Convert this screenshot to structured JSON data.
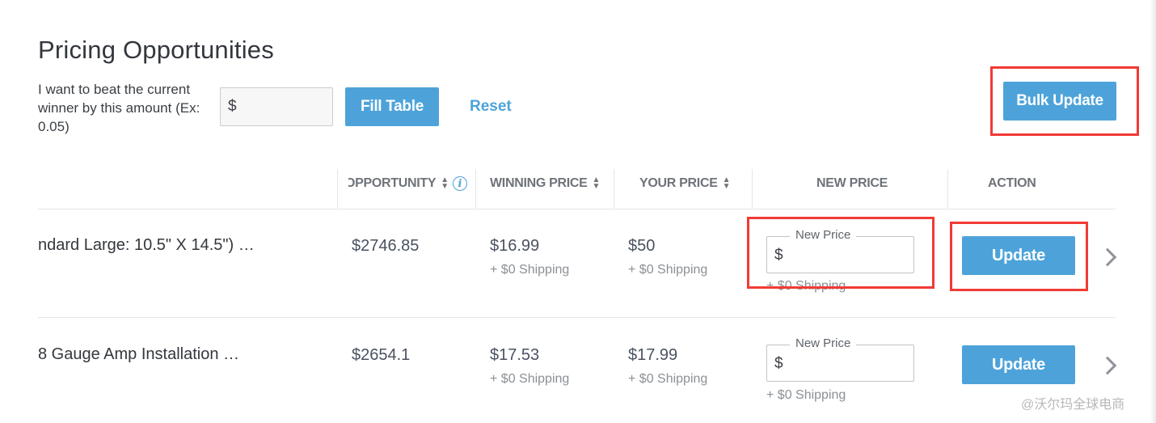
{
  "header": {
    "title": "Pricing Opportunities",
    "beat_label": "I want to beat the current winner by this amount (Ex: 0.05)",
    "beat_input_prefix": "$",
    "fill_table_label": "Fill Table",
    "reset_label": "Reset",
    "bulk_update_label": "Bulk Update"
  },
  "table": {
    "columns": [
      "OPPORTUNITY",
      "WINNING PRICE",
      "YOUR PRICE",
      "NEW PRICE",
      "ACTION"
    ],
    "rows": [
      {
        "product": "ndard Large: 10.5\" X 14.5\") …",
        "opportunity": "$2746.85",
        "winning_price": "$16.99",
        "winning_shipping": "+ $0 Shipping",
        "your_price": "$50",
        "your_shipping": "+ $0 Shipping",
        "new_price_label": "New Price",
        "new_price_prefix": "$",
        "new_price_shipping": "+ $0 Shipping",
        "action_label": "Update"
      },
      {
        "product": "8 Gauge Amp Installation …",
        "opportunity": "$2654.1",
        "winning_price": "$17.53",
        "winning_shipping": "+ $0 Shipping",
        "your_price": "$17.99",
        "your_shipping": "+ $0 Shipping",
        "new_price_label": "New Price",
        "new_price_prefix": "$",
        "new_price_shipping": "+ $0 Shipping",
        "action_label": "Update"
      }
    ]
  },
  "icons": {
    "sort": "sort-icon",
    "info": "info-icon",
    "chevron": "chevron-right-icon"
  },
  "colors": {
    "accent": "#4da3d9",
    "highlight": "#f23a35"
  },
  "watermark": "@沃尔玛全球电商"
}
